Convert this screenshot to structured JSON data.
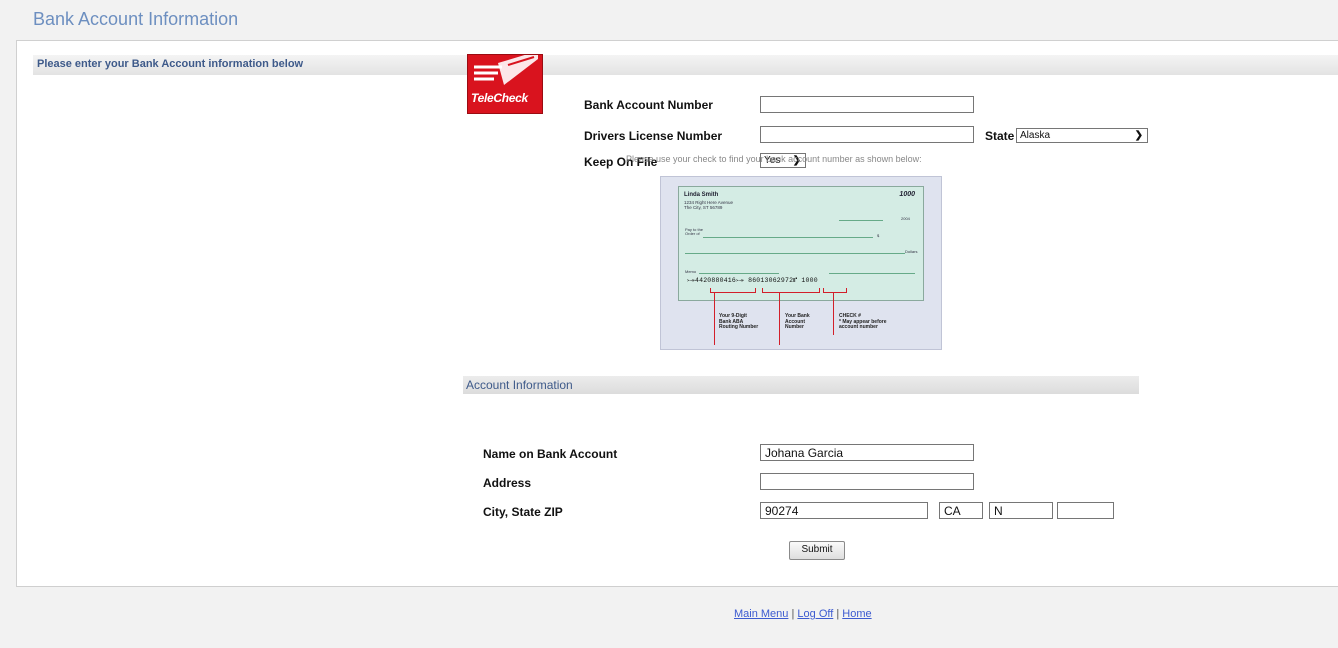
{
  "page": {
    "title": "Bank Account Information"
  },
  "section": {
    "title": "Please enter your Bank Account information below"
  },
  "logo": {
    "text": "TeleCheck"
  },
  "bank_form": {
    "account_number_label": "Bank Account Number",
    "account_number_value": "",
    "license_label": "Drivers License Number",
    "license_value": "",
    "state_label": "State",
    "state_selected": "Alaska",
    "keep_on_file_label": "Keep On File",
    "keep_on_file_selected": "Yes"
  },
  "check_help": {
    "hint": "Please use your check to find your bank account number as shown below:",
    "check": {
      "name": "Linda Smith",
      "address1": "1234 Right Here Avenue",
      "address2": "The City, ST 56789",
      "number": "1000",
      "date_suffix": "2004",
      "pay_to": "Pay to the",
      "order_of": "Order of",
      "dollar_sign": "$",
      "dollars": "Dollars",
      "memo": "Memo",
      "micr": "⤐4420880416⤐ 86013062972⑈ 1000"
    },
    "captions": {
      "routing": [
        "Your 9-Digit",
        "Bank ABA",
        "Routing Number"
      ],
      "account": [
        "Your Bank",
        "Account",
        "Number"
      ],
      "check_num": [
        "CHECK #",
        "* May appear before",
        "account number"
      ]
    }
  },
  "account_info": {
    "title": "Account Information",
    "name_label": "Name on Bank Account",
    "name_value": "Johana Garcia",
    "address_label": "Address",
    "address_value": "",
    "city_label": "City, State ZIP",
    "city_value": "90274",
    "state_value": "CA",
    "zip_value": "N",
    "zip_ext_value": "",
    "submit_label": "Submit"
  },
  "footer": {
    "main_menu": "Main Menu",
    "log_off": "Log Off",
    "home": "Home",
    "separator": "|"
  },
  "colors": {
    "title": "#6d8fc0",
    "section_text": "#3e5a8a",
    "logo_red": "#d9131e",
    "link": "#3d5bd0"
  }
}
